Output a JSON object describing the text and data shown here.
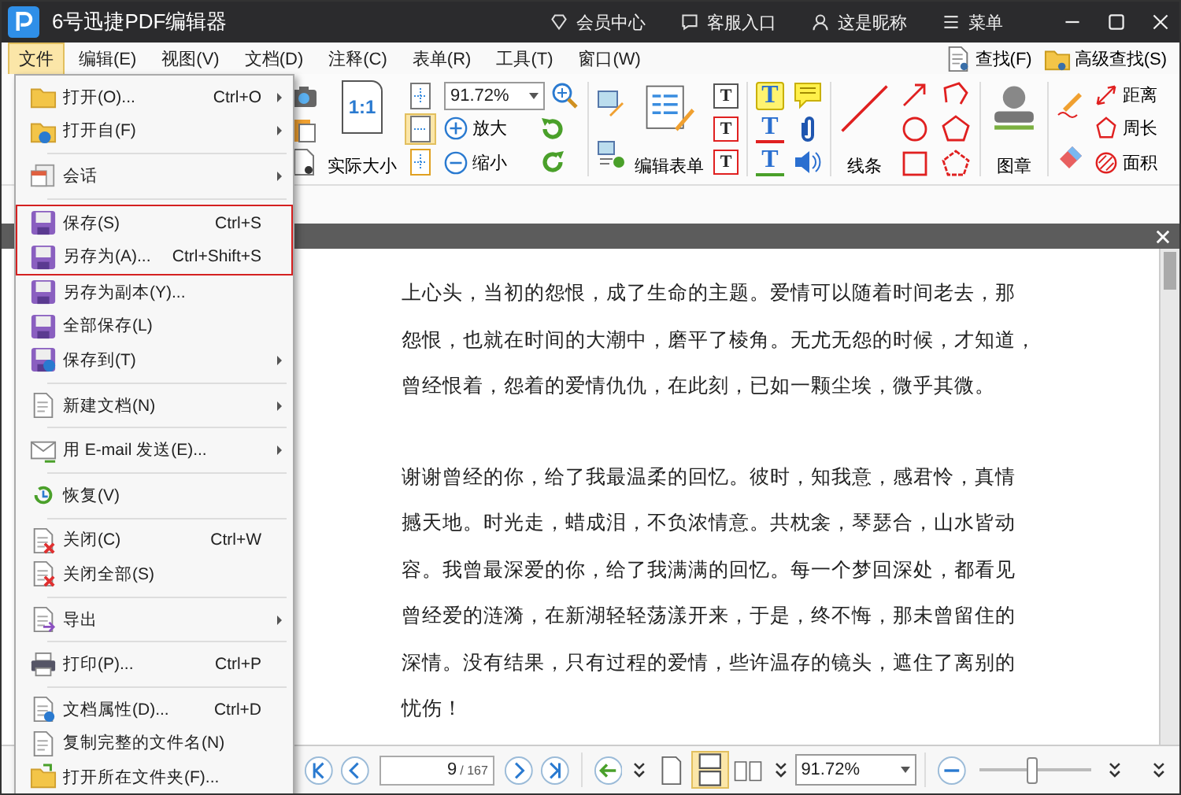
{
  "window": {
    "title": "6号迅捷PDF编辑器",
    "header_links": [
      {
        "kind": "vip",
        "label": "会员中心"
      },
      {
        "kind": "service",
        "label": "客服入口"
      },
      {
        "kind": "user",
        "label": "这是昵称"
      },
      {
        "kind": "menu",
        "label": "菜单"
      }
    ]
  },
  "menu_bar": [
    {
      "label": "文件",
      "selected": true
    },
    {
      "label": "编辑(E)",
      "selected": false
    },
    {
      "label": "视图(V)",
      "selected": false
    },
    {
      "label": "文档(D)",
      "selected": false
    },
    {
      "label": "注释(C)",
      "selected": false
    },
    {
      "label": "表单(R)",
      "selected": false
    },
    {
      "label": "工具(T)",
      "selected": false
    },
    {
      "label": "窗口(W)",
      "selected": false
    }
  ],
  "search_buttons": [
    {
      "kind": "find",
      "label": "查找(F)"
    },
    {
      "kind": "advanced",
      "label": "高级查找(S)"
    }
  ],
  "ribbon": {
    "actual_size_glyph": "1:1",
    "actual_size": "实际大小",
    "zoom": "91.72%",
    "zoom_in": "放大",
    "zoom_out": "缩小",
    "edit_form": "编辑表单",
    "form_field_glyphs": [
      "T",
      "T",
      "T"
    ],
    "text_markup_glyphs": [
      "T",
      "T",
      "T"
    ],
    "line": "线条",
    "stamp": "图章",
    "distance": "距离",
    "perimeter": "周长",
    "area": "面积"
  },
  "file_menu": [
    {
      "kind": "item",
      "label": "打开(O)...",
      "shortcut": "Ctrl+O",
      "submenu": true,
      "highlighted": false
    },
    {
      "kind": "item",
      "label": "打开自(F)",
      "submenu": true,
      "highlighted": false
    },
    {
      "kind": "separator"
    },
    {
      "kind": "item",
      "label": "会话",
      "submenu": true,
      "highlighted": false
    },
    {
      "kind": "separator"
    },
    {
      "kind": "item",
      "label": "保存(S)",
      "shortcut": "Ctrl+S",
      "submenu": false,
      "highlighted": true
    },
    {
      "kind": "item",
      "label": "另存为(A)...",
      "shortcut": "Ctrl+Shift+S",
      "submenu": false,
      "highlighted": true
    },
    {
      "kind": "item",
      "label": "另存为副本(Y)...",
      "submenu": false,
      "highlighted": false
    },
    {
      "kind": "item",
      "label": "全部保存(L)",
      "submenu": false,
      "highlighted": false
    },
    {
      "kind": "item",
      "label": "保存到(T)",
      "submenu": true,
      "highlighted": false
    },
    {
      "kind": "separator"
    },
    {
      "kind": "item",
      "label": "新建文档(N)",
      "submenu": true,
      "highlighted": false
    },
    {
      "kind": "separator"
    },
    {
      "kind": "item",
      "label": "用 E-mail 发送(E)...",
      "submenu": true,
      "highlighted": false
    },
    {
      "kind": "separator"
    },
    {
      "kind": "item",
      "label": "恢复(V)",
      "submenu": false,
      "highlighted": false
    },
    {
      "kind": "separator"
    },
    {
      "kind": "item",
      "label": "关闭(C)",
      "shortcut": "Ctrl+W",
      "submenu": false,
      "highlighted": false
    },
    {
      "kind": "item",
      "label": "关闭全部(S)",
      "submenu": false,
      "highlighted": false
    },
    {
      "kind": "separator"
    },
    {
      "kind": "item",
      "label": "导出",
      "submenu": true,
      "highlighted": false
    },
    {
      "kind": "separator"
    },
    {
      "kind": "item",
      "label": "打印(P)...",
      "shortcut": "Ctrl+P",
      "submenu": false,
      "highlighted": false
    },
    {
      "kind": "separator"
    },
    {
      "kind": "item",
      "label": "文档属性(D)...",
      "shortcut": "Ctrl+D",
      "submenu": false,
      "highlighted": false
    },
    {
      "kind": "item",
      "label": "复制完整的文件名(N)",
      "submenu": false,
      "highlighted": false
    },
    {
      "kind": "item",
      "label": "打开所在文件夹(F)...",
      "submenu": false,
      "highlighted": false
    }
  ],
  "document": {
    "paragraphs": [
      [
        "上心头，当初的怨恨，成了生命的主题。爱情可以随着时间老去，那",
        "怨恨，也就在时间的大潮中，磨平了棱角。无尤无怨的时候，才知道，",
        "曾经恨着，怨着的爱情仇仇，在此刻，已如一颗尘埃，微乎其微。"
      ],
      [
        "谢谢曾经的你，给了我最温柔的回忆。彼时，知我意，感君怜，真情",
        "撼天地。时光走，蜡成泪，不负浓情意。共枕衾，琴瑟合，山水皆动",
        "容。我曾最深爱的你，给了我满满的回忆。每一个梦回深处，都看见",
        "曾经爱的涟漪，在新湖轻轻荡漾开来，于是，终不悔，那未曾留住的",
        "深情。没有结果，只有过程的爱情，些许温存的镜头，遮住了离别的",
        "忧伤！"
      ]
    ]
  },
  "status_bar": {
    "page": "9",
    "total": "/ 167",
    "zoom": "91.72%",
    "zoom_slider": {
      "level": 0.47
    }
  }
}
